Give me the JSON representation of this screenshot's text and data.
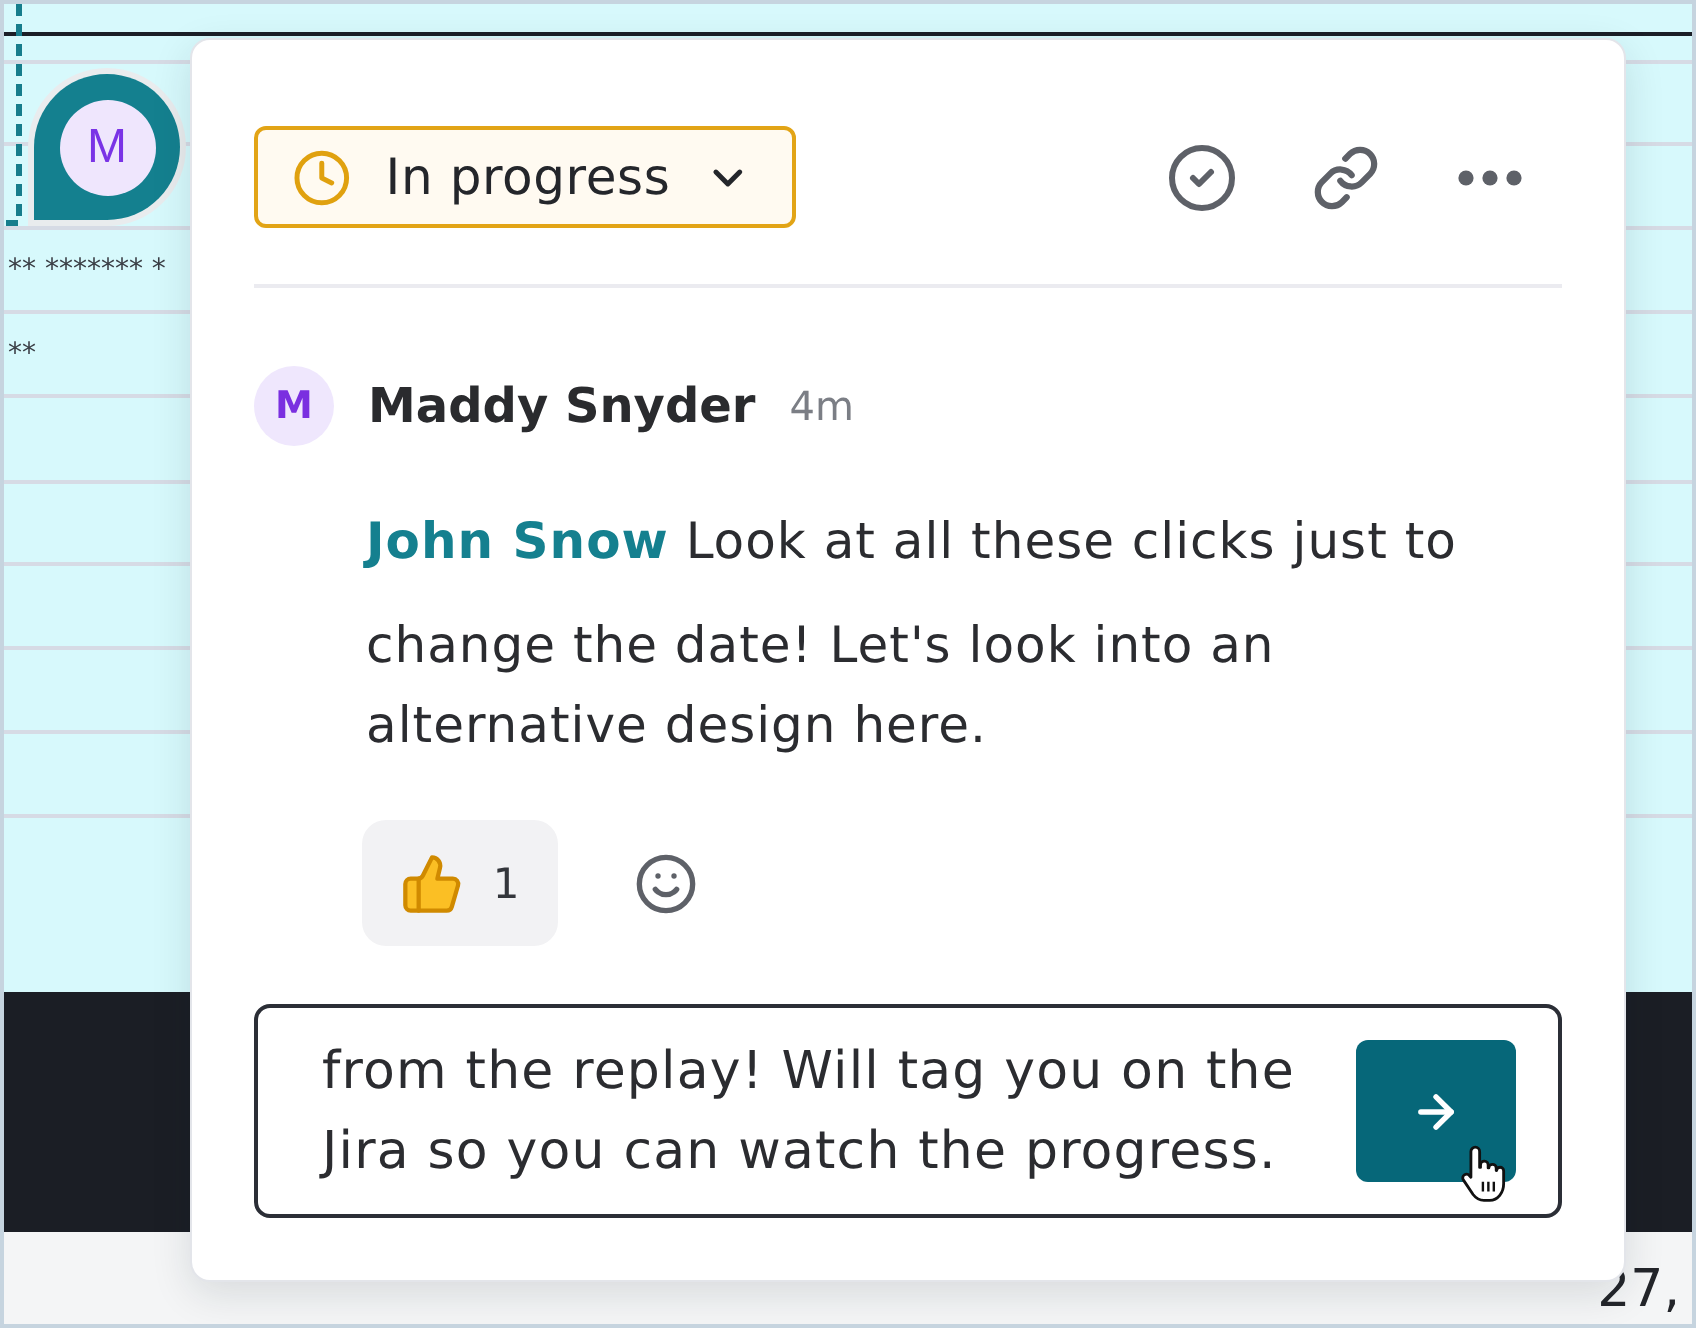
{
  "background": {
    "rows": [
      {
        "text": "** ******* *"
      },
      {
        "text": "**"
      }
    ],
    "date": "27,"
  },
  "pin": {
    "initial": "M"
  },
  "popup": {
    "status": {
      "label": "In progress"
    },
    "comment": {
      "avatar_initial": "M",
      "author": "Maddy Snyder",
      "time": "4m",
      "mention": "John Snow",
      "text": "Look at all these clicks just to change the date! Let's look into an alternative design here."
    },
    "reactions": [
      {
        "count": "1"
      }
    ],
    "reply": {
      "value": "from the replay! Will tag you on the Jira so you can watch the progress."
    }
  }
}
